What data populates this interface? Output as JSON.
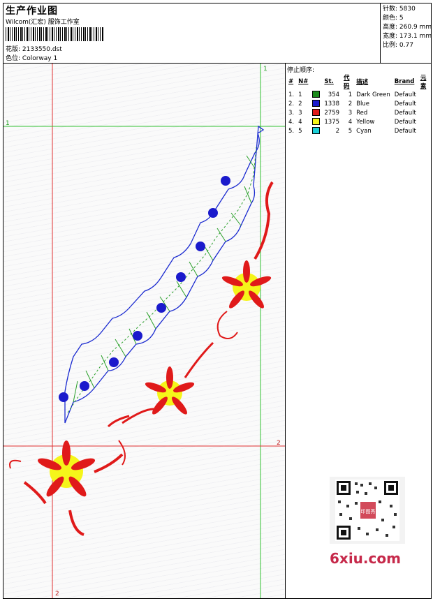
{
  "header": {
    "title": "生产作业图",
    "company": "Wilcom(汇宏) 服饰工作室",
    "design_label": "花版:",
    "design_file": "2133550.dst",
    "colorway_label": "色位:",
    "colorway": "Colorway 1"
  },
  "stats": {
    "stitches_label": "针数:",
    "stitches": "5830",
    "colors_label": "颜色:",
    "colors": "5",
    "height_label": "高度:",
    "height": "260.9 mm",
    "width_label": "宽度:",
    "width": "173.1 mm",
    "scale_label": "比例:",
    "scale": "0.77"
  },
  "sequence": {
    "title": "停止顺序:",
    "headers": [
      "#",
      "N#",
      "St.",
      "代码",
      "描述",
      "Brand",
      "元素"
    ],
    "rows": [
      {
        "idx": "1.",
        "n": "1",
        "color": "#1a8a1a",
        "st": "354",
        "code": "1",
        "desc": "Dark Green",
        "brand": "Default"
      },
      {
        "idx": "2.",
        "n": "2",
        "color": "#1a1acc",
        "st": "1338",
        "code": "2",
        "desc": "Blue",
        "brand": "Default"
      },
      {
        "idx": "3.",
        "n": "3",
        "color": "#e01a1a",
        "st": "2759",
        "code": "3",
        "desc": "Red",
        "brand": "Default"
      },
      {
        "idx": "4.",
        "n": "4",
        "color": "#f5f51a",
        "st": "1375",
        "code": "4",
        "desc": "Yellow",
        "brand": "Default"
      },
      {
        "idx": "5.",
        "n": "5",
        "color": "#1ad0d8",
        "st": "2",
        "code": "5",
        "desc": "Cyan",
        "brand": "Default"
      }
    ]
  },
  "guides": {
    "v1": "1",
    "h1": "1",
    "h2": "2",
    "v2": "2"
  },
  "watermark": "6xiu.com",
  "qr_stamp": "印图秀"
}
